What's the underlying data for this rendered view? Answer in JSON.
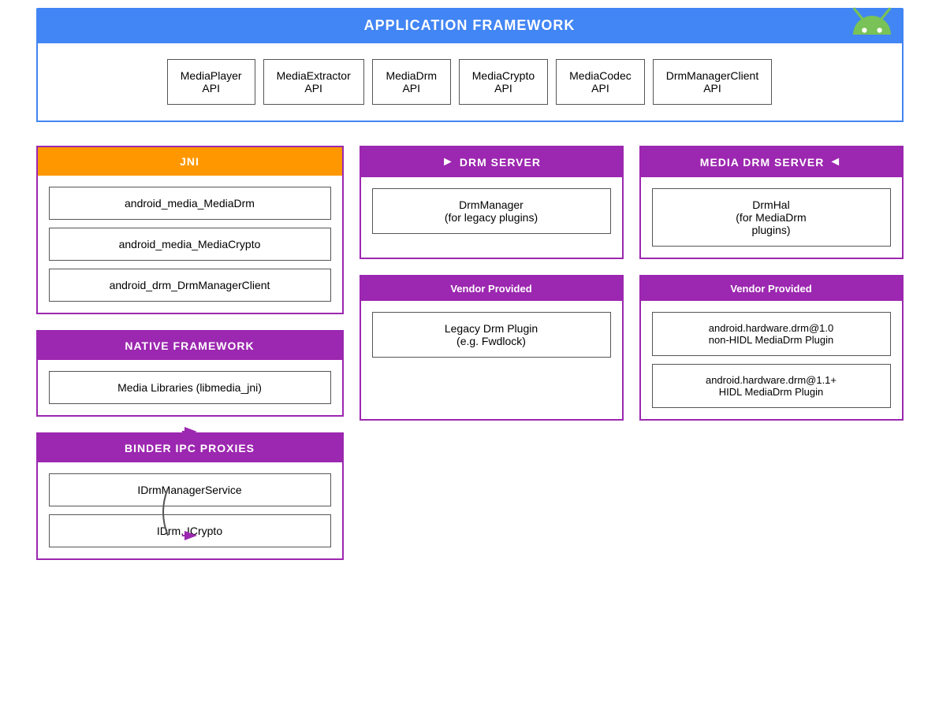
{
  "android_logo_color": "#78c257",
  "app_framework": {
    "header": "APPLICATION FRAMEWORK",
    "apis": [
      {
        "line1": "MediaPlayer",
        "line2": "API"
      },
      {
        "line1": "MediaExtractor",
        "line2": "API"
      },
      {
        "line1": "MediaDrm",
        "line2": "API"
      },
      {
        "line1": "MediaCrypto",
        "line2": "API"
      },
      {
        "line1": "MediaCodec",
        "line2": "API"
      },
      {
        "line1": "DrmManagerClient",
        "line2": "API"
      }
    ]
  },
  "jni": {
    "header": "JNI",
    "header_color": "orange",
    "items": [
      "android_media_MediaDrm",
      "android_media_MediaCrypto",
      "android_drm_DrmManagerClient"
    ]
  },
  "native_framework": {
    "header": "NATIVE FRAMEWORK",
    "header_color": "purple",
    "items": [
      "Media Libraries (libmedia_jni)"
    ]
  },
  "binder_ipc": {
    "header": "BINDER IPC PROXIES",
    "header_color": "purple",
    "items": [
      "IDrmManagerService",
      "IDrm, ICrypto"
    ]
  },
  "drm_server": {
    "header": "DRM SERVER",
    "header_color": "purple",
    "items": [
      "DrmManager\n(for legacy plugins)"
    ]
  },
  "media_drm_server": {
    "header": "MEDIA DRM SERVER",
    "header_color": "purple",
    "items": [
      "DrmHal\n(for MediaDrm\nplugins)"
    ]
  },
  "vendor_provided_left": {
    "header": "Vendor Provided",
    "items": [
      "Legacy Drm Plugin\n(e.g. Fwdlock)"
    ]
  },
  "vendor_provided_right": {
    "header": "Vendor Provided",
    "items": [
      "android.hardware.drm@1.0\nnon-HIDL MediaDrm Plugin",
      "android.hardware.drm@1.1+\nHIDL MediaDrm Plugin"
    ]
  }
}
